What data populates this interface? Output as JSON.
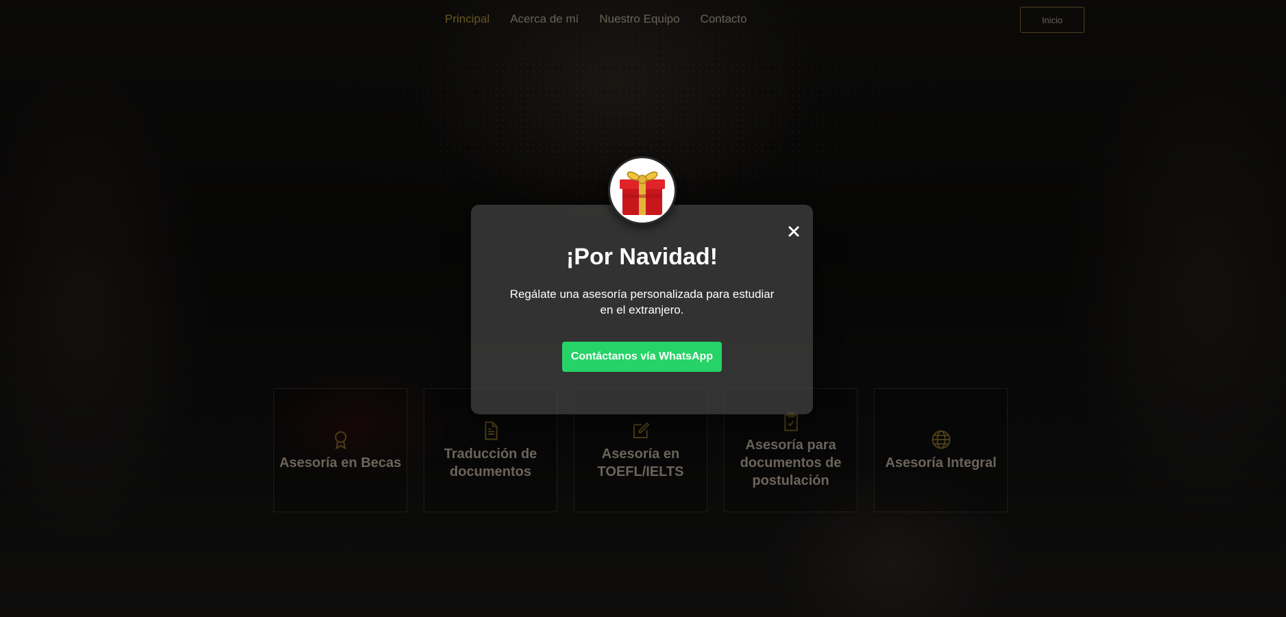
{
  "nav": {
    "links": [
      "Principal",
      "Acerca de mí",
      "Nuestro Equipo",
      "Contacto"
    ],
    "active_index": 0,
    "cta_label": "Inicio"
  },
  "services": [
    {
      "title": "Asesoría en Becas",
      "icon": "award-icon"
    },
    {
      "title": "Traducción de documentos",
      "icon": "document-icon"
    },
    {
      "title": "Asesoría en TOEFL/IELTS",
      "icon": "edit-icon"
    },
    {
      "title": "Asesoría para documentos de postulación",
      "icon": "clipboard-check-icon"
    },
    {
      "title": "Asesoría Integral",
      "icon": "globe-icon"
    }
  ],
  "popup": {
    "title": "¡Por Navidad!",
    "text": "Regálate una asesoría personalizada para estudiar en el extranjero.",
    "button_label": "Contáctanos vía WhatsApp",
    "icon": "gift-icon",
    "close_icon": "close-icon"
  },
  "colors": {
    "accent_gold": "#b8901f",
    "whatsapp_green": "#26d366",
    "modal_bg": "#4e4e4e"
  }
}
